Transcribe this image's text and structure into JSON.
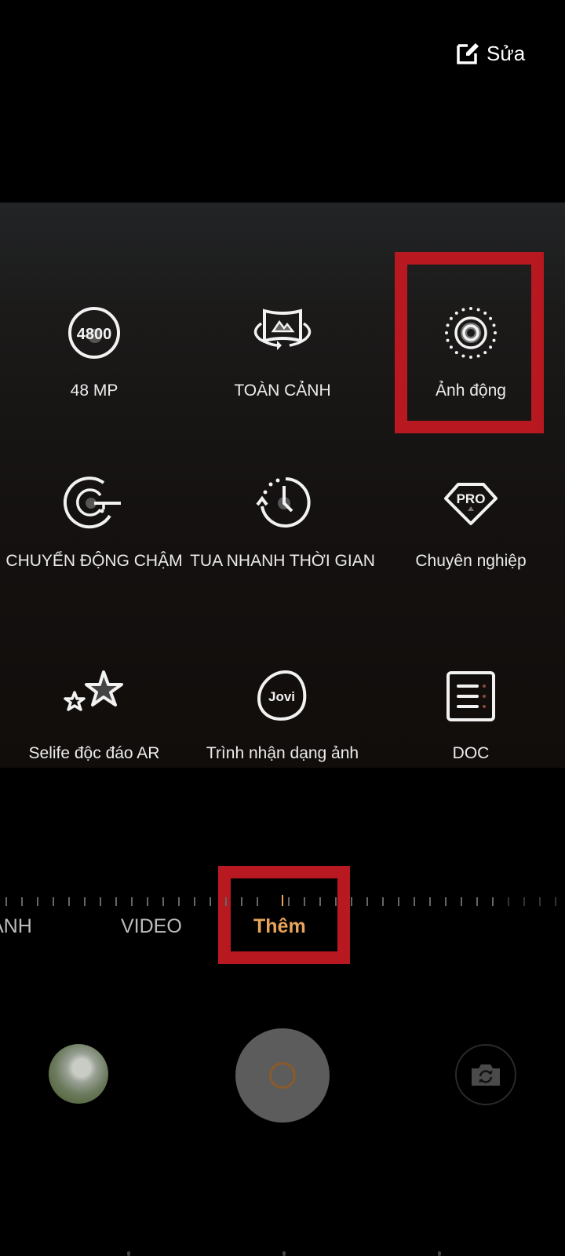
{
  "header": {
    "edit_label": "Sửa",
    "edit_icon": "edit-icon"
  },
  "modes_grid": [
    {
      "label": "48 MP",
      "icon": "48mp-icon",
      "icon_text": "4800"
    },
    {
      "label": "TOÀN CẢNH",
      "icon": "panorama-icon"
    },
    {
      "label": "Ảnh động",
      "icon": "live-photo-icon",
      "highlighted": true
    },
    {
      "label": "CHUYỂN ĐỘNG CHẬM",
      "icon": "slow-motion-icon"
    },
    {
      "label": "TUA NHANH THỜI GIAN",
      "icon": "time-lapse-icon"
    },
    {
      "label": "Chuyên nghiệp",
      "icon": "pro-icon",
      "icon_text": "PRO"
    },
    {
      "label": "Selife độc đáo AR",
      "icon": "ar-stickers-icon"
    },
    {
      "label": "Trình nhận dạng ảnh",
      "icon": "jovi-icon",
      "icon_text": "Jovi"
    },
    {
      "label": "DOC",
      "icon": "document-icon"
    }
  ],
  "mode_bar": {
    "tabs": [
      {
        "label": "ẢNH",
        "active": false
      },
      {
        "label": "VIDEO",
        "active": false
      },
      {
        "label": "Thêm",
        "active": true
      }
    ]
  },
  "colors": {
    "accent": "#e9a45b",
    "highlight_box": "#b8181f",
    "shutter": "#5c5c5c"
  }
}
